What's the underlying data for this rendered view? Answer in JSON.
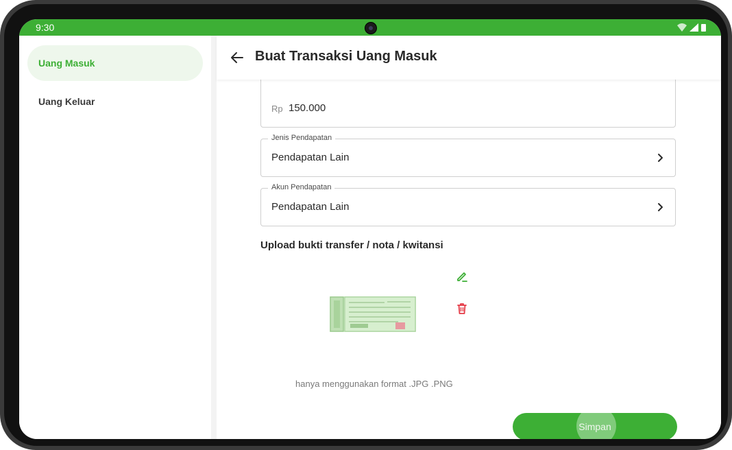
{
  "status_bar": {
    "time": "9:30"
  },
  "sidebar": {
    "items": [
      {
        "label": "Uang Masuk",
        "active": true
      },
      {
        "label": "Uang Keluar",
        "active": false
      }
    ]
  },
  "header": {
    "title": "Buat Transaksi Uang Masuk"
  },
  "form": {
    "amount": {
      "prefix": "Rp",
      "value": "150.000"
    },
    "income_type": {
      "label": "Jenis Pendapatan",
      "value": "Pendapatan Lain"
    },
    "income_account": {
      "label": "Akun Pendapatan",
      "value": "Pendapatan Lain"
    }
  },
  "upload": {
    "title": "Upload bukti transfer / nota / kwitansi",
    "hint": "hanya menggunakan format .JPG .PNG"
  },
  "actions": {
    "save_label": "Simpan"
  },
  "colors": {
    "primary": "#3daf35",
    "danger": "#e53945",
    "active_bg": "#eef7ec"
  },
  "icons": [
    "wifi-icon",
    "signal-icon",
    "battery-icon",
    "back-arrow-icon",
    "chevron-right-icon",
    "edit-pencil-icon",
    "trash-icon"
  ]
}
